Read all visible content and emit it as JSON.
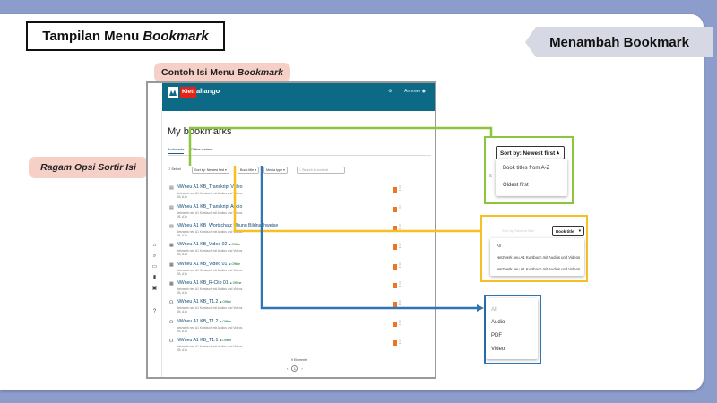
{
  "slide": {
    "title_plain": "Tampilan Menu",
    "title_italic": "Bookmark",
    "banner": "Menambah Bookmark",
    "label_example_plain": "Contoh Isi Menu",
    "label_example_italic": "Bookmark",
    "label_sort": "Ragam Opsi Sortir Isi",
    "colors": {
      "green": "#8cc63f",
      "yellow": "#f6c025",
      "blue": "#2e75b6",
      "background": "#8c9dcc",
      "header": "#0c6a86"
    }
  },
  "app": {
    "logo_icon": "klett-logo-icon",
    "brand_klett": "Klett",
    "brand_allango": "allango",
    "header_user": "Annowe",
    "page_title": "My bookmarks",
    "tabs": [
      "Bookmarks",
      "Offline content"
    ],
    "filters": {
      "select_all": "Select",
      "sort": "Sort by: Newest first",
      "book": "Book title",
      "media": "Media type",
      "search_placeholder": "Search in content"
    },
    "rows": [
      {
        "icon": "document-icon",
        "title": "NWneu A1 KB_Transkript Video",
        "sub": "Netzwerk neu A1 Kursbuch mit Audios und Videos",
        "sub2": "KB, A1b",
        "offline": ""
      },
      {
        "icon": "document-icon",
        "title": "NWneu A1 KB_Transkript Audio",
        "sub": "Netzwerk neu A1 Kursbuch mit Audios und Videos",
        "sub2": "KB, A1b",
        "offline": ""
      },
      {
        "icon": "document-icon",
        "title": "NWneu A1 KB_Wortschatz Übung Bildnachweise",
        "sub": "Netzwerk neu A1 Kursbuch mit Audios und Videos",
        "sub2": "KB, A1b",
        "offline": ""
      },
      {
        "icon": "video-icon",
        "title": "NWneu A1 KB_Video 02",
        "sub": "Netzwerk neu A1 Kursbuch mit Audios und Videos",
        "sub2": "KB, A1b",
        "offline": "● Offline"
      },
      {
        "icon": "video-icon",
        "title": "NWneu A1 KB_Video 01",
        "sub": "Netzwerk neu A1 Kursbuch mit Audios und Videos",
        "sub2": "KB, A1b",
        "offline": "● Offline"
      },
      {
        "icon": "video-icon",
        "title": "NWneu A1 KB_R-Clip 01",
        "sub": "Netzwerk neu A1 Kursbuch mit Audios und Videos",
        "sub2": "KB, A1b",
        "offline": "● Offline"
      },
      {
        "icon": "headphones-icon",
        "title": "NWneu A1 KB_T1.2",
        "sub": "Netzwerk neu A1 Kursbuch mit Audios und Videos",
        "sub2": "KB, A1b",
        "offline": "● Offline"
      },
      {
        "icon": "headphones-icon",
        "title": "NWneu A1 KB_T1.2",
        "sub": "Netzwerk neu A1 Kursbuch mit Audios und Videos",
        "sub2": "KB, A1b",
        "offline": "● Offline"
      },
      {
        "icon": "headphones-icon",
        "title": "NWneu A1 KB_T1.1",
        "sub": "Netzwerk neu A1 Kursbuch mit Audios und Videos",
        "sub2": "KB, A1b",
        "offline": "● Offline"
      }
    ],
    "result_count": "9 Elements",
    "page_current": "1"
  },
  "popups": {
    "sort": {
      "button": "Sort by: Newest first",
      "options": [
        "Book titles from A-Z",
        "Oldest first"
      ]
    },
    "book": {
      "button": "Book title",
      "hidden_label": "Sort by: Newest first",
      "options": [
        "All",
        "Netzwerk neu A1 Kursbuch mit Audios und Videos",
        "Netzwerk neu A1 Kursbuch mit Audios und Videos"
      ]
    },
    "media": {
      "options": [
        "All",
        "Audio",
        "PDF",
        "Video"
      ]
    }
  }
}
